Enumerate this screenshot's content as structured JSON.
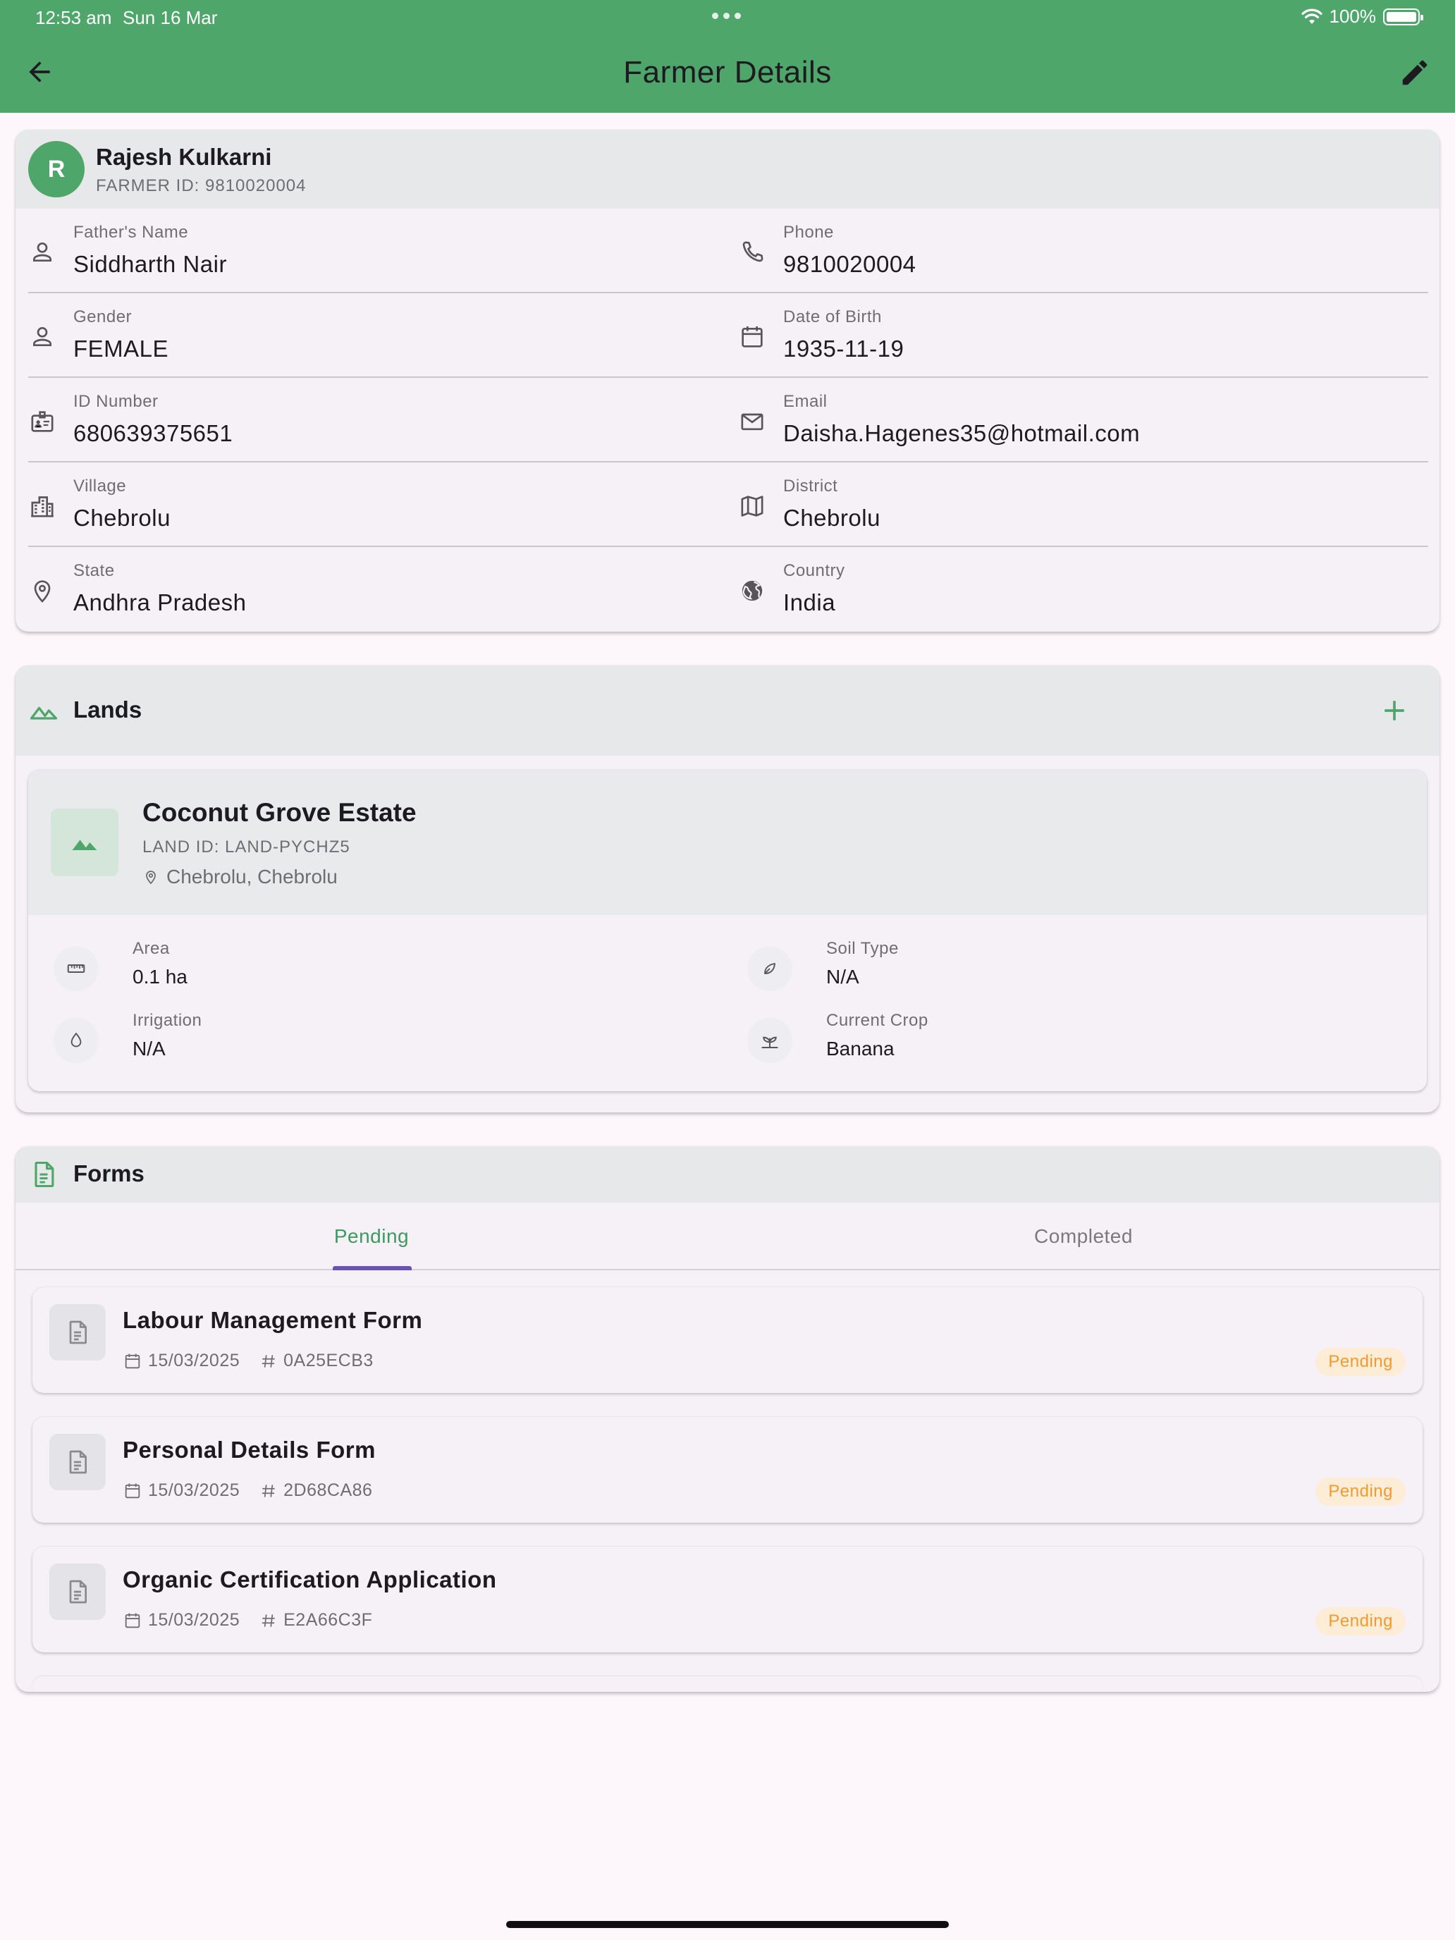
{
  "status_bar": {
    "time": "12:53 am",
    "date": "Sun 16 Mar",
    "battery": "100%",
    "battery_level": 1.0
  },
  "app_bar": {
    "title": "Farmer Details"
  },
  "colors": {
    "brand": "#4fa66b",
    "tab_indicator": "#6b52b7",
    "pending_text": "#f29a2e",
    "pending_bg": "#fdecd6"
  },
  "profile": {
    "avatar_initial": "R",
    "name": "Rajesh Kulkarni",
    "farmer_id": "FARMER ID: 9810020004",
    "fields": [
      {
        "label": "Father's Name",
        "value": "Siddharth Nair",
        "icon": "person-icon"
      },
      {
        "label": "Phone",
        "value": "9810020004",
        "icon": "phone-icon"
      },
      {
        "label": "Gender",
        "value": "FEMALE",
        "icon": "person-icon"
      },
      {
        "label": "Date of Birth",
        "value": "1935-11-19",
        "icon": "calendar-icon"
      },
      {
        "label": "ID Number",
        "value": "680639375651",
        "icon": "id-card-icon"
      },
      {
        "label": "Email",
        "value": "Daisha.Hagenes35@hotmail.com",
        "icon": "mail-icon"
      },
      {
        "label": "Village",
        "value": "Chebrolu",
        "icon": "buildings-icon"
      },
      {
        "label": "District",
        "value": "Chebrolu",
        "icon": "map-icon"
      },
      {
        "label": "State",
        "value": "Andhra Pradesh",
        "icon": "location-pin-icon"
      },
      {
        "label": "Country",
        "value": "India",
        "icon": "globe-icon"
      }
    ]
  },
  "lands": {
    "title": "Lands",
    "items": [
      {
        "name": "Coconut Grove Estate",
        "land_id": "LAND ID: LAND-PYCHZ5",
        "location": "Chebrolu, Chebrolu",
        "attributes": [
          {
            "label": "Area",
            "value": "0.1 ha",
            "icon": "ruler-icon"
          },
          {
            "label": "Soil Type",
            "value": "N/A",
            "icon": "leaf-icon"
          },
          {
            "label": "Irrigation",
            "value": "N/A",
            "icon": "water-drop-icon"
          },
          {
            "label": "Current Crop",
            "value": "Banana",
            "icon": "crop-icon"
          }
        ]
      }
    ]
  },
  "forms": {
    "title": "Forms",
    "tabs": [
      {
        "label": "Pending",
        "active": true
      },
      {
        "label": "Completed",
        "active": false
      }
    ],
    "items": [
      {
        "title": "Labour Management Form",
        "date": "15/03/2025",
        "code": "0A25ECB3",
        "status": "Pending"
      },
      {
        "title": "Personal Details Form",
        "date": "15/03/2025",
        "code": "2D68CA86",
        "status": "Pending"
      },
      {
        "title": "Organic Certification Application",
        "date": "15/03/2025",
        "code": "E2A66C3F",
        "status": "Pending"
      }
    ]
  }
}
